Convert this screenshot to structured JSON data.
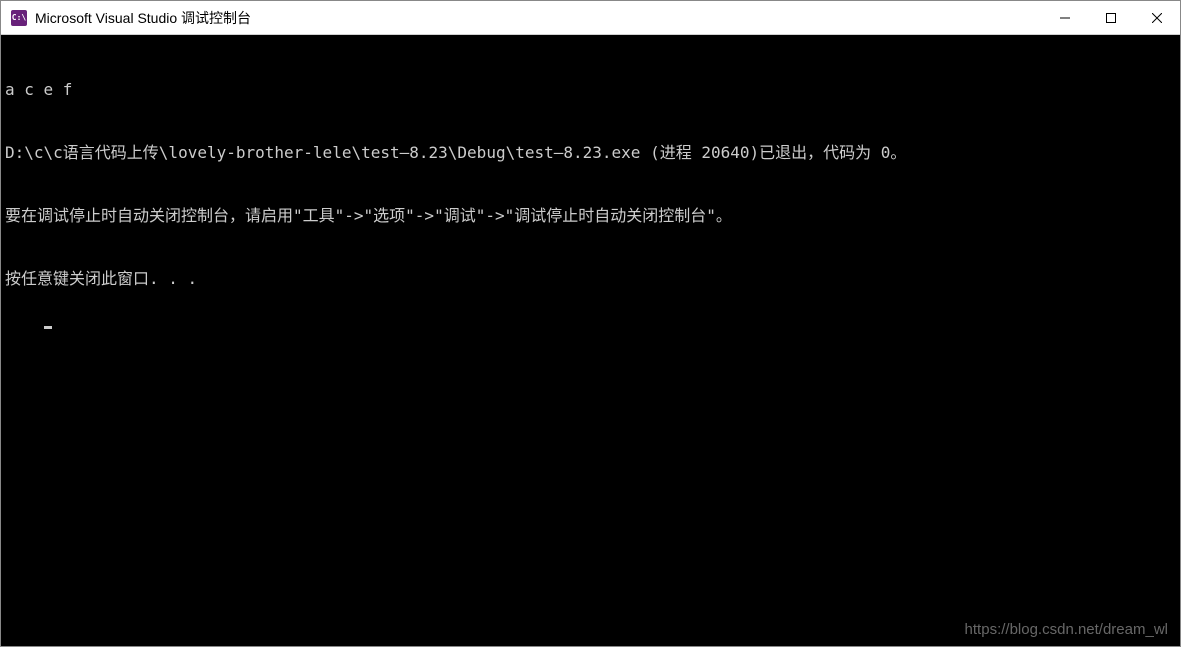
{
  "window": {
    "icon_text": "C:\\",
    "title": "Microsoft Visual Studio 调试控制台"
  },
  "console": {
    "lines": [
      "a c e f",
      "D:\\c\\c语言代码上传\\lovely-brother-lele\\test—8.23\\Debug\\test—8.23.exe (进程 20640)已退出，代码为 0。",
      "要在调试停止时自动关闭控制台，请启用\"工具\"->\"选项\"->\"调试\"->\"调试停止时自动关闭控制台\"。",
      "按任意键关闭此窗口. . ."
    ]
  },
  "watermark": "https://blog.csdn.net/dream_wl"
}
